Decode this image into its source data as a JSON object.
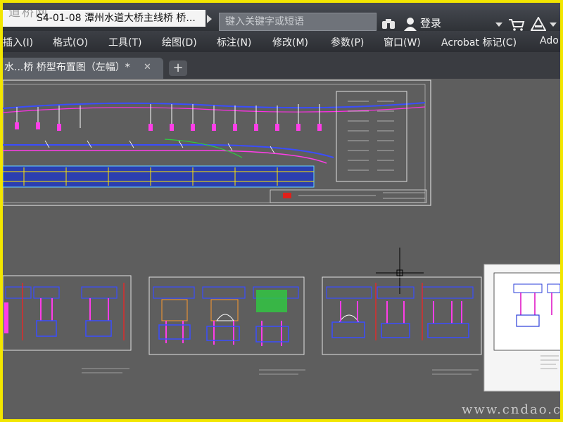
{
  "titlebar": {
    "watermark": "道桥网",
    "title": "S4-01-08 潭州水道大桥主线桥 桥...",
    "search_placeholder": "键入关键字或短语",
    "login_label": "登录"
  },
  "menu": [
    "插入(I)",
    "格式(O)",
    "工具(T)",
    "绘图(D)",
    "标注(N)",
    "修改(M)",
    "参数(P)",
    "窗口(W)",
    "Acrobat 标记(C)",
    "Ado"
  ],
  "tabs": {
    "active_label": "水...桥 桥型布置图（左幅）*",
    "close_glyph": "✕",
    "add_glyph": "+"
  },
  "watermark_bottom": "www.cndao.com",
  "icons": [
    "binoculars-icon",
    "user-icon",
    "dropdown-arrow-icon",
    "cart-icon",
    "triangle-warning-icon",
    "crosshair-cursor-icon"
  ]
}
